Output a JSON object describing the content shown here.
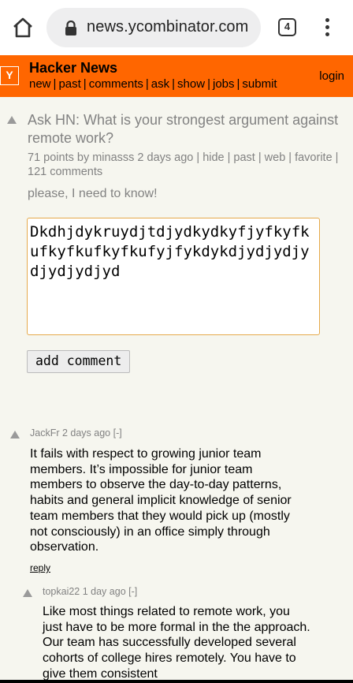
{
  "browser": {
    "url": "news.ycombinator.com",
    "tab_count": "4"
  },
  "header": {
    "logo": "Y",
    "site_title": "Hacker News",
    "nav": [
      "new",
      "past",
      "comments",
      "ask",
      "show",
      "jobs",
      "submit"
    ],
    "login": "login"
  },
  "story": {
    "title": "Ask HN: What is your strongest argument against remote work?",
    "subtext": "71 points by minasss 2 days ago | hide | past | web | favorite | 121 comments",
    "text": "please, I need to know!"
  },
  "reply_form": {
    "value": "Dkdhjdykruydjtdjydkydkyfjyfkyfkufkyfkufkyfkufyjfykdykdjydjydjydjydjydjyd",
    "button_label": "add comment"
  },
  "comments": [
    {
      "header": "JackFr 2 days ago [-]",
      "body": "It fails with respect to growing junior team members. It’s impossible for junior team members to observe the day-to-day patterns, habits and general implicit knowledge of senior team members that they would pick up (mostly not consciously) in an office simply through observation.",
      "reply": "reply"
    },
    {
      "header": "topkai22 1 day ago [-]",
      "body": "Like most things related to remote work, you just have to be more formal in the the approach. Our team has successfully developed several cohorts of college hires remotely. You have to give them consistent"
    }
  ],
  "colors": {
    "hn_orange": "#ff6600",
    "page_bg": "#f6f6ef",
    "subtext_gray": "#828282"
  }
}
